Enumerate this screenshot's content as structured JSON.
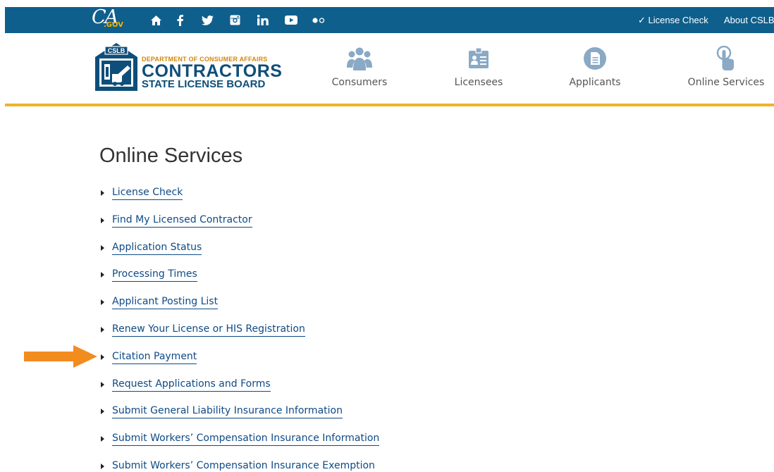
{
  "topbar": {
    "ca_logo_text": "CA",
    "ca_logo_sub": ".GOV",
    "social_icons": [
      "home-icon",
      "facebook-icon",
      "twitter-icon",
      "instagram-icon",
      "linkedin-icon",
      "youtube-icon",
      "flickr-icon"
    ],
    "links": [
      {
        "label": "✓ License Check"
      },
      {
        "label": "About CSLB"
      }
    ],
    "colors": {
      "bar": "#0f5f8c",
      "accent": "#f0b323"
    }
  },
  "header": {
    "logo": {
      "badge": "CSLB",
      "department": "DEPARTMENT OF CONSUMER AFFAIRS",
      "name": "CONTRACTORS",
      "board": "STATE LICENSE BOARD"
    },
    "nav": [
      {
        "label": "Consumers",
        "icon": "people-icon"
      },
      {
        "label": "Licensees",
        "icon": "id-card-icon"
      },
      {
        "label": "Applicants",
        "icon": "document-icon"
      },
      {
        "label": "Online Services",
        "icon": "pointer-hand-icon"
      }
    ]
  },
  "main": {
    "title": "Online Services",
    "services": [
      "License Check",
      "Find My Licensed Contractor",
      "Application Status",
      "Processing Times",
      "Applicant Posting List",
      "Renew Your License or HIS Registration",
      "Citation Payment",
      "Request Applications and Forms",
      "Submit General Liability Insurance Information",
      "Submit Workers’ Compensation Insurance Information",
      "Submit Workers’ Compensation Insurance Exemption"
    ],
    "highlighted_service": "Citation Payment",
    "highlight_color": "#f28c1f"
  }
}
